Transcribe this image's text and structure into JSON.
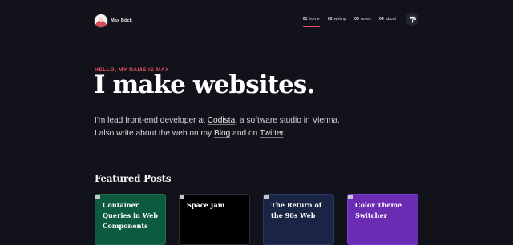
{
  "site": {
    "brand_name": "Max Böck"
  },
  "nav": {
    "items": [
      {
        "num": "01",
        "label": "home",
        "active": true
      },
      {
        "num": "02",
        "label": "writing",
        "active": false
      },
      {
        "num": "03",
        "label": "notes",
        "active": false
      },
      {
        "num": "04",
        "label": "about",
        "active": false
      }
    ],
    "theme_toggle_icon": "paint-roller-icon"
  },
  "hero": {
    "kicker": "HELLO, MY NAME IS MAX",
    "title": "I make websites.",
    "desc_part1": "I'm lead front-end developer at ",
    "link_codista": "Codista",
    "desc_part2": ", a software studio in Vienna.",
    "desc_part3": "I also write about the web on my ",
    "link_blog": "Blog",
    "desc_part4": " and on ",
    "link_twitter": "Twitter",
    "desc_part5": "."
  },
  "featured": {
    "title": "Featured Posts",
    "posts": [
      {
        "title": "Container Queries in Web Components",
        "color": "#0c5b3f"
      },
      {
        "title": "Space Jam",
        "color": "#000000"
      },
      {
        "title": "The Return of the 90s Web",
        "color": "#1a2444"
      },
      {
        "title": "Color Theme Switcher",
        "color": "#6c2bb3"
      }
    ]
  },
  "colors": {
    "background": "#12131a",
    "accent": "#f05166"
  }
}
